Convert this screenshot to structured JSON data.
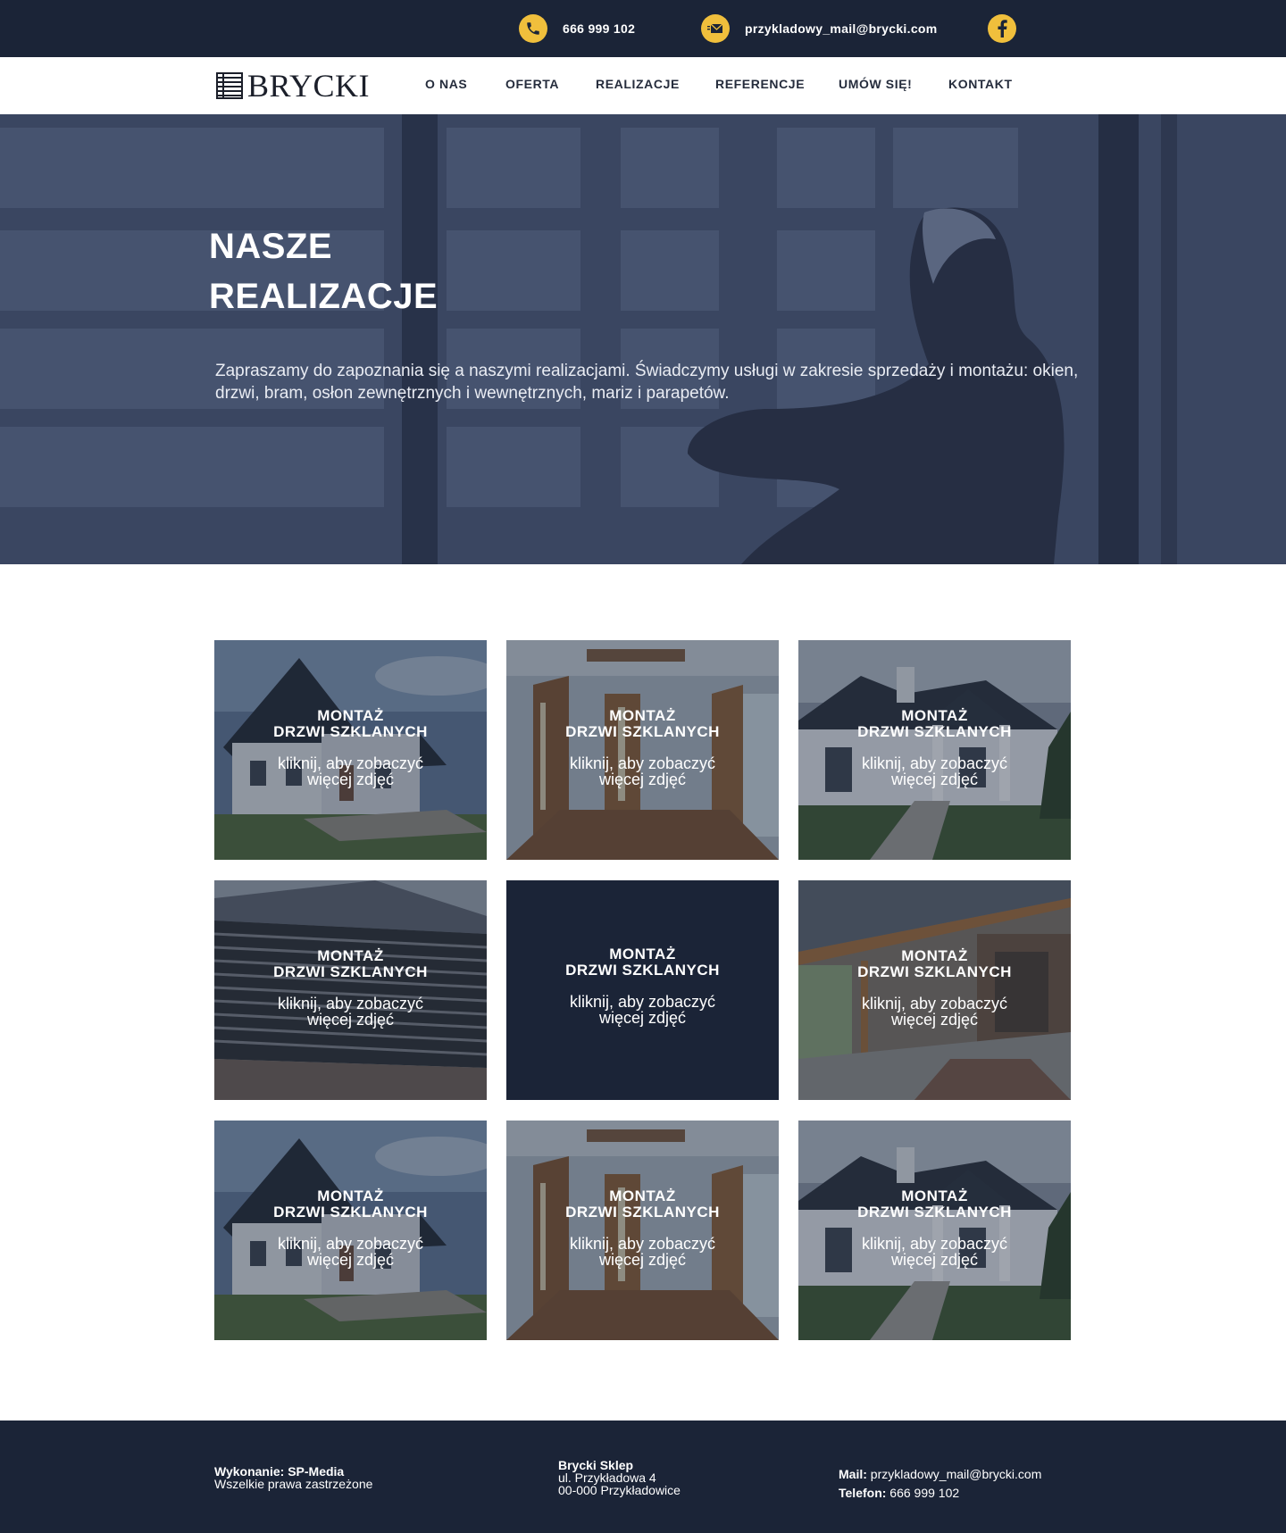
{
  "topbar": {
    "phone": "666 999 102",
    "email": "przykladowy_mail@brycki.com",
    "icons": [
      "phone-icon",
      "mail-icon",
      "facebook-icon"
    ],
    "accent_color": "#f0bf3c",
    "background_color": "#1b2437"
  },
  "header": {
    "logo_text": "BRYCKI",
    "nav": [
      "O NAS",
      "OFERTA",
      "REALIZACJE",
      "REFERENCJE",
      "UMÓW SIĘ!",
      "KONTAKT"
    ]
  },
  "hero": {
    "title_line1": "NASZE",
    "title_line2": "REALIZACJE",
    "description": "Zapraszamy do zapoznania się a naszymi realizacjami. Świadczymy usługi w zakresie sprzedaży i montażu: okien, drzwi, bram, osłon zewnętrznych i wewnętrznych, mariz i parapetów."
  },
  "gallery": {
    "items": [
      {
        "title_line1": "MONTAŻ",
        "title_line2": "DRZWI SZKLANYCH",
        "sub_line1": "kliknij, aby zobaczyć",
        "sub_line2": "więcej zdjęć",
        "image": "house-exterior"
      },
      {
        "title_line1": "MONTAŻ",
        "title_line2": "DRZWI SZKLANYCH",
        "sub_line1": "kliknij, aby zobaczyć",
        "sub_line2": "więcej zdjęć",
        "image": "interior-doors"
      },
      {
        "title_line1": "MONTAŻ",
        "title_line2": "DRZWI SZKLANYCH",
        "sub_line1": "kliknij, aby zobaczyć",
        "sub_line2": "więcej zdjęć",
        "image": "house-with-porch"
      },
      {
        "title_line1": "MONTAŻ",
        "title_line2": "DRZWI SZKLANYCH",
        "sub_line1": "kliknij, aby zobaczyć",
        "sub_line2": "więcej zdjęć",
        "image": "modern-facade-blinds"
      },
      {
        "title_line1": "MONTAŻ",
        "title_line2": "DRZWI SZKLANYCH",
        "sub_line1": "kliknij, aby zobaczyć",
        "sub_line2": "więcej zdjęć",
        "image": "none"
      },
      {
        "title_line1": "MONTAŻ",
        "title_line2": "DRZWI SZKLANYCH",
        "sub_line1": "kliknij, aby zobaczyć",
        "sub_line2": "więcej zdjęć",
        "image": "terrace-roof"
      },
      {
        "title_line1": "MONTAŻ",
        "title_line2": "DRZWI SZKLANYCH",
        "sub_line1": "kliknij, aby zobaczyć",
        "sub_line2": "więcej zdjęć",
        "image": "house-exterior"
      },
      {
        "title_line1": "MONTAŻ",
        "title_line2": "DRZWI SZKLANYCH",
        "sub_line1": "kliknij, aby zobaczyć",
        "sub_line2": "więcej zdjęć",
        "image": "interior-doors"
      },
      {
        "title_line1": "MONTAŻ",
        "title_line2": "DRZWI SZKLANYCH",
        "sub_line1": "kliknij, aby zobaczyć",
        "sub_line2": "więcej zdjęć",
        "image": "house-with-porch"
      }
    ]
  },
  "footer": {
    "credit_label": "Wykonanie: SP-Media",
    "rights": "Wszelkie prawa zastrzeżone",
    "shop_name": "Brycki Sklep",
    "street": "ul. Przykładowa 4",
    "city": "00-000 Przykładowice",
    "mail_label": "Mail:",
    "mail_value": "przykladowy_mail@brycki.com",
    "phone_label": "Telefon:",
    "phone_value": "666 999 102"
  }
}
